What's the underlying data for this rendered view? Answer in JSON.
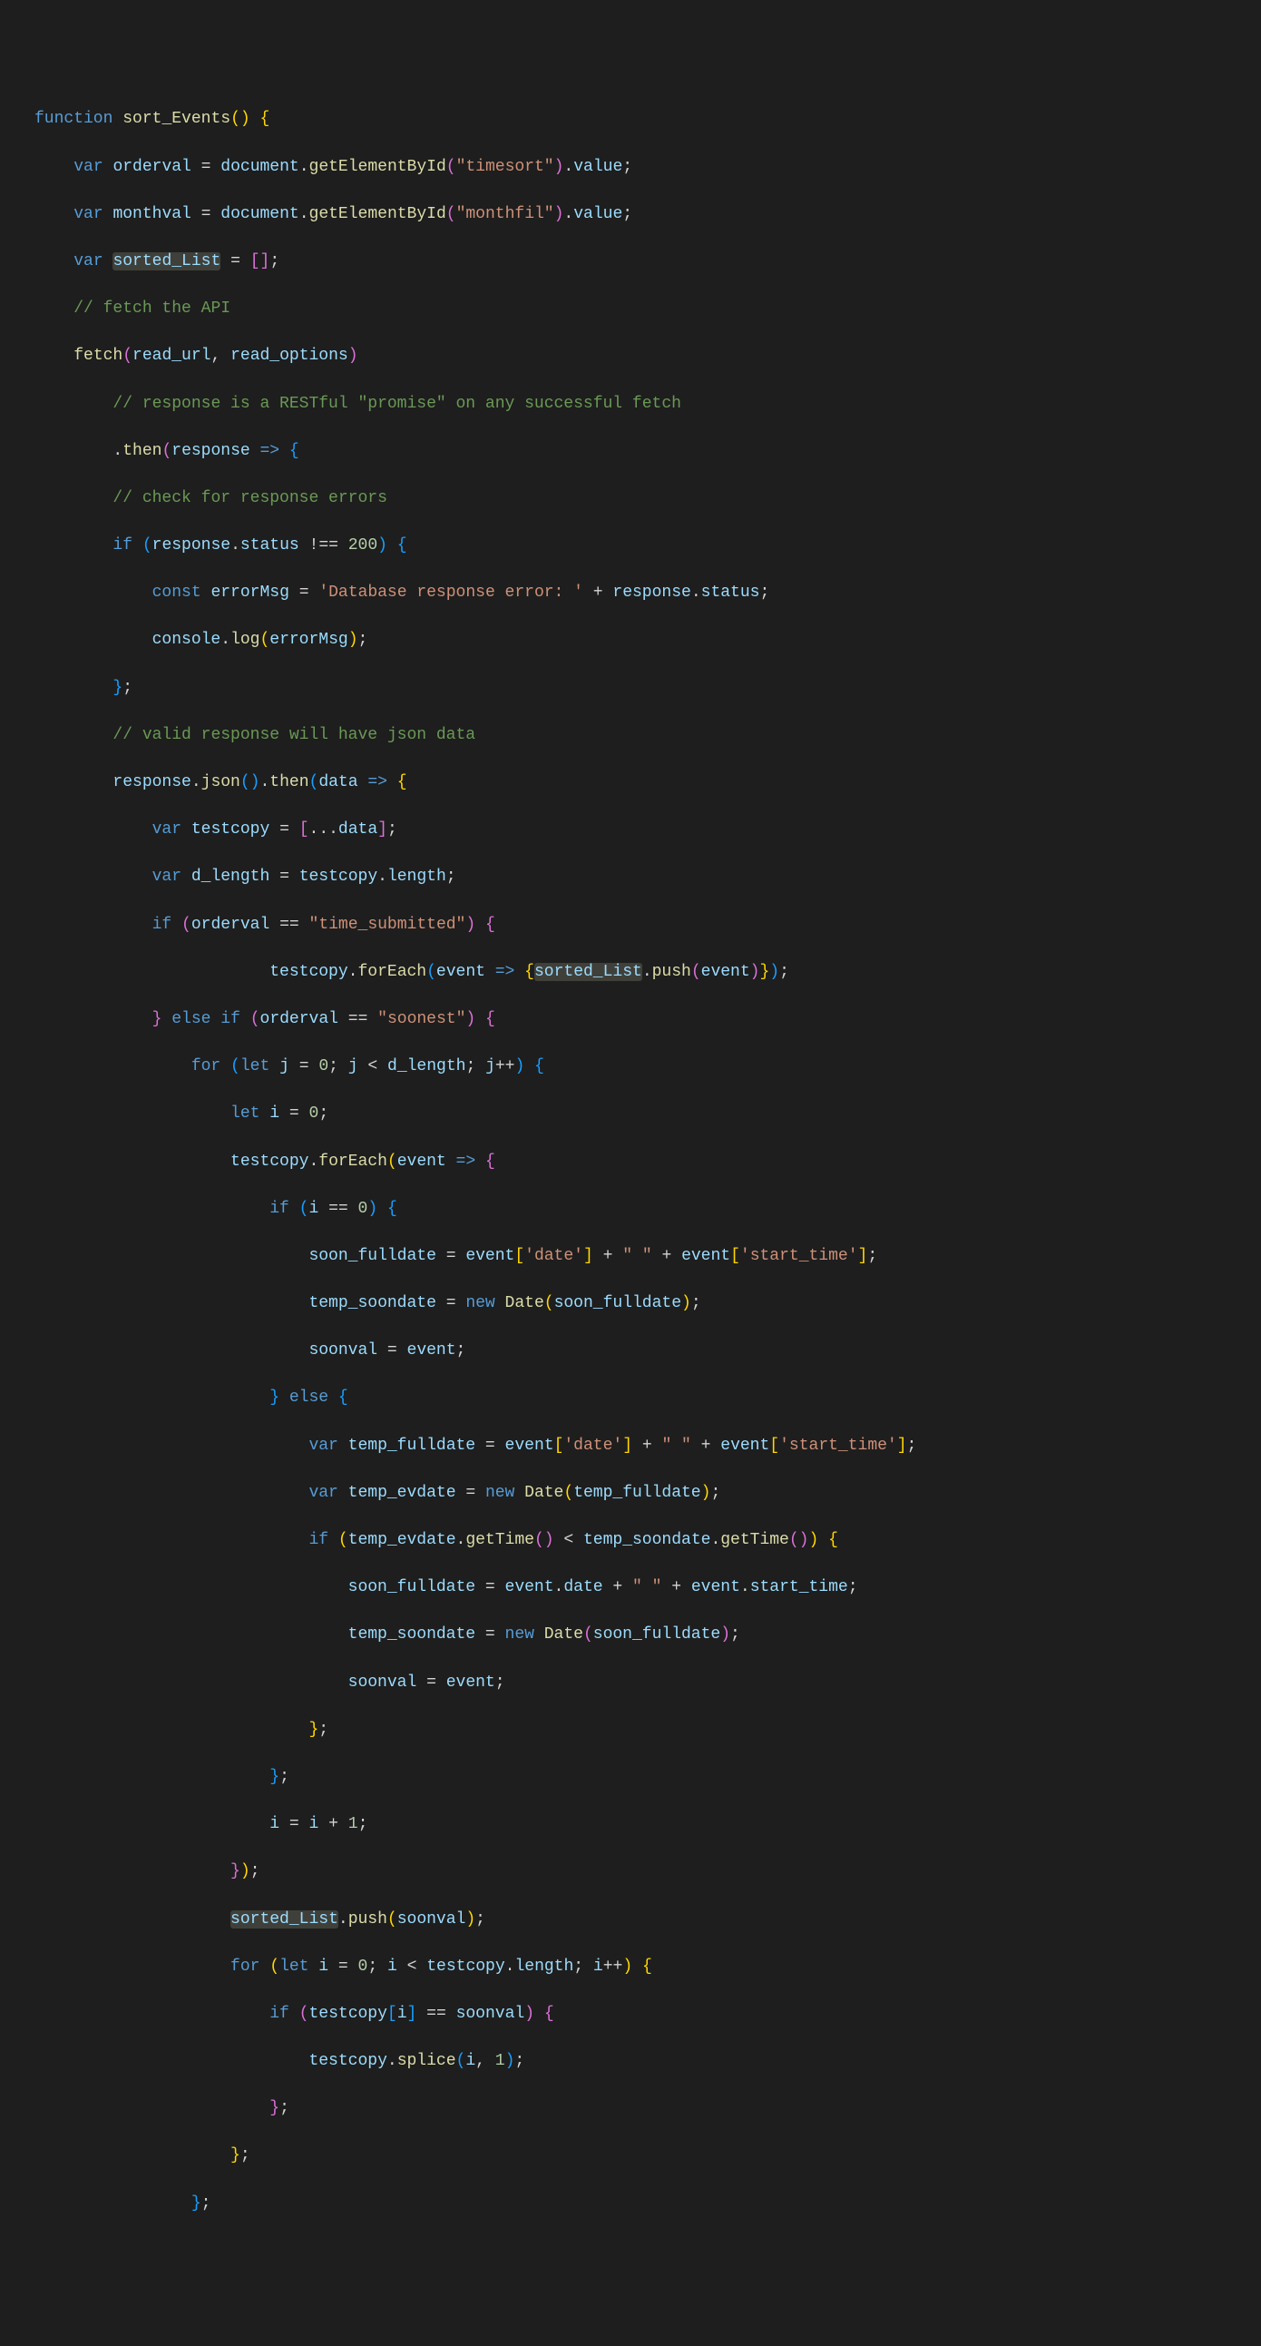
{
  "code": {
    "fn_decl": "function",
    "fn_name": "sort_Events",
    "var_kw": "var",
    "let_kw": "let",
    "const_kw": "const",
    "if_kw": "if",
    "else_kw": "else",
    "for_kw": "for",
    "new_kw": "new",
    "orderval": "orderval",
    "monthval": "monthval",
    "sorted_List": "sorted_List",
    "document": "document",
    "getElementById": "getElementById",
    "timesort_str": "\"timesort\"",
    "monthfil_str": "\"monthfil\"",
    "value": "value",
    "comment_fetch": "// fetch the API",
    "fetch": "fetch",
    "read_url": "read_url",
    "read_options": "read_options",
    "comment_response": "// response is a RESTful \"promise\" on any successful fetch",
    "then": "then",
    "response": "response",
    "comment_check": "// check for response errors",
    "status": "status",
    "num200": "200",
    "errorMsg": "errorMsg",
    "errstr": "'Database response error: '",
    "console": "console",
    "log": "log",
    "comment_valid": "// valid response will have json data",
    "json": "json",
    "data": "data",
    "testcopy": "testcopy",
    "d_length": "d_length",
    "length": "length",
    "time_submitted_str": "\"time_submitted\"",
    "forEach": "forEach",
    "event": "event",
    "push": "push",
    "soonest_str": "\"soonest\"",
    "j": "j",
    "i": "i",
    "num0": "0",
    "num1": "1",
    "soon_fulldate": "soon_fulldate",
    "date_key": "'date'",
    "space_str": "\" \"",
    "start_time_key": "'start_time'",
    "temp_soondate": "temp_soondate",
    "Date": "Date",
    "soonval": "soonval",
    "temp_fulldate": "temp_fulldate",
    "temp_evdate": "temp_evdate",
    "getTime": "getTime",
    "date_prop": "date",
    "start_time_prop": "start_time",
    "splice": "splice"
  }
}
